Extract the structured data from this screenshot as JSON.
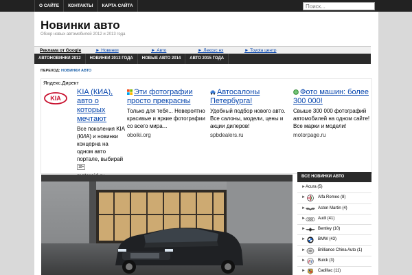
{
  "top_nav": [
    "О САЙТЕ",
    "КОНТАКТЫ",
    "КАРТА САЙТА"
  ],
  "search": {
    "placeholder": "Поиск..."
  },
  "site": {
    "title": "Новинки авто",
    "description": "Обзор новых автомобилей 2012 и 2013 года"
  },
  "ad_links": {
    "label": "Реклама от Google",
    "items": [
      "► Новинки",
      "► Авто",
      "► Лексус нх",
      "► Toyota центр"
    ]
  },
  "category_nav": [
    "АВТОНОВИНКИ 2012",
    "НОВИНКИ 2013 ГОДА",
    "НОВЫЕ АВТО 2014",
    "АВТО 2015 ГОДА"
  ],
  "breadcrumb": {
    "prefix": "ПЕРЕХОД:",
    "current": "НОВИНКИ АВТО"
  },
  "yandex_direct": {
    "title": "Яндекс.Директ",
    "ads": [
      {
        "headline": "KIA (КИА), авто о которых мечтают",
        "text": "Все поколения KIA (КИА) и новинки концерна на одном авто портале, выбирай",
        "age": "18+",
        "domain": "motoroid.ru",
        "icon": "kia-logo"
      },
      {
        "headline": "Эти фотографии просто прекрасны",
        "text": "Только для тебя... Невероятно красивые и яркие фотографии со всего мира...",
        "domain": "oboiki.org",
        "icon": "windows-icon"
      },
      {
        "headline": "Автосалоны Петербурга!",
        "text": "Удобный подбор нового авто. Все салоны, модели, цены и акции дилеров!",
        "domain": "spbdealers.ru",
        "icon": "car-icon"
      },
      {
        "headline": "Фото машин: более 300 000!",
        "text": "Свыше 300 000 фотографий автомобилей на одном сайте! Все марки и модели!",
        "domain": "motorpage.ru",
        "icon": "globe-icon"
      }
    ]
  },
  "sidebar": {
    "title": "ВСЕ НОВИНКИ АВТО",
    "brands": [
      {
        "label": "Acura (5)",
        "logo": "none"
      },
      {
        "label": "Alfa Romeo (8)",
        "logo": "alfa-romeo"
      },
      {
        "label": "Aston Martin (4)",
        "logo": "aston-martin"
      },
      {
        "label": "Audi (41)",
        "logo": "audi"
      },
      {
        "label": "Bentley (10)",
        "logo": "bentley"
      },
      {
        "label": "BMW (43)",
        "logo": "bmw"
      },
      {
        "label": "Brilliance China Auto (1)",
        "logo": "brilliance"
      },
      {
        "label": "Buick (3)",
        "logo": "buick"
      },
      {
        "label": "Cadillac (11)",
        "logo": "cadillac"
      }
    ]
  },
  "colors": {
    "top_bar": "#222222",
    "nav_bar": "#2a2a2a",
    "link": "#0645ad",
    "breadcrumb_current": "#1a5fa8",
    "page_background": "#d9d9d9"
  }
}
